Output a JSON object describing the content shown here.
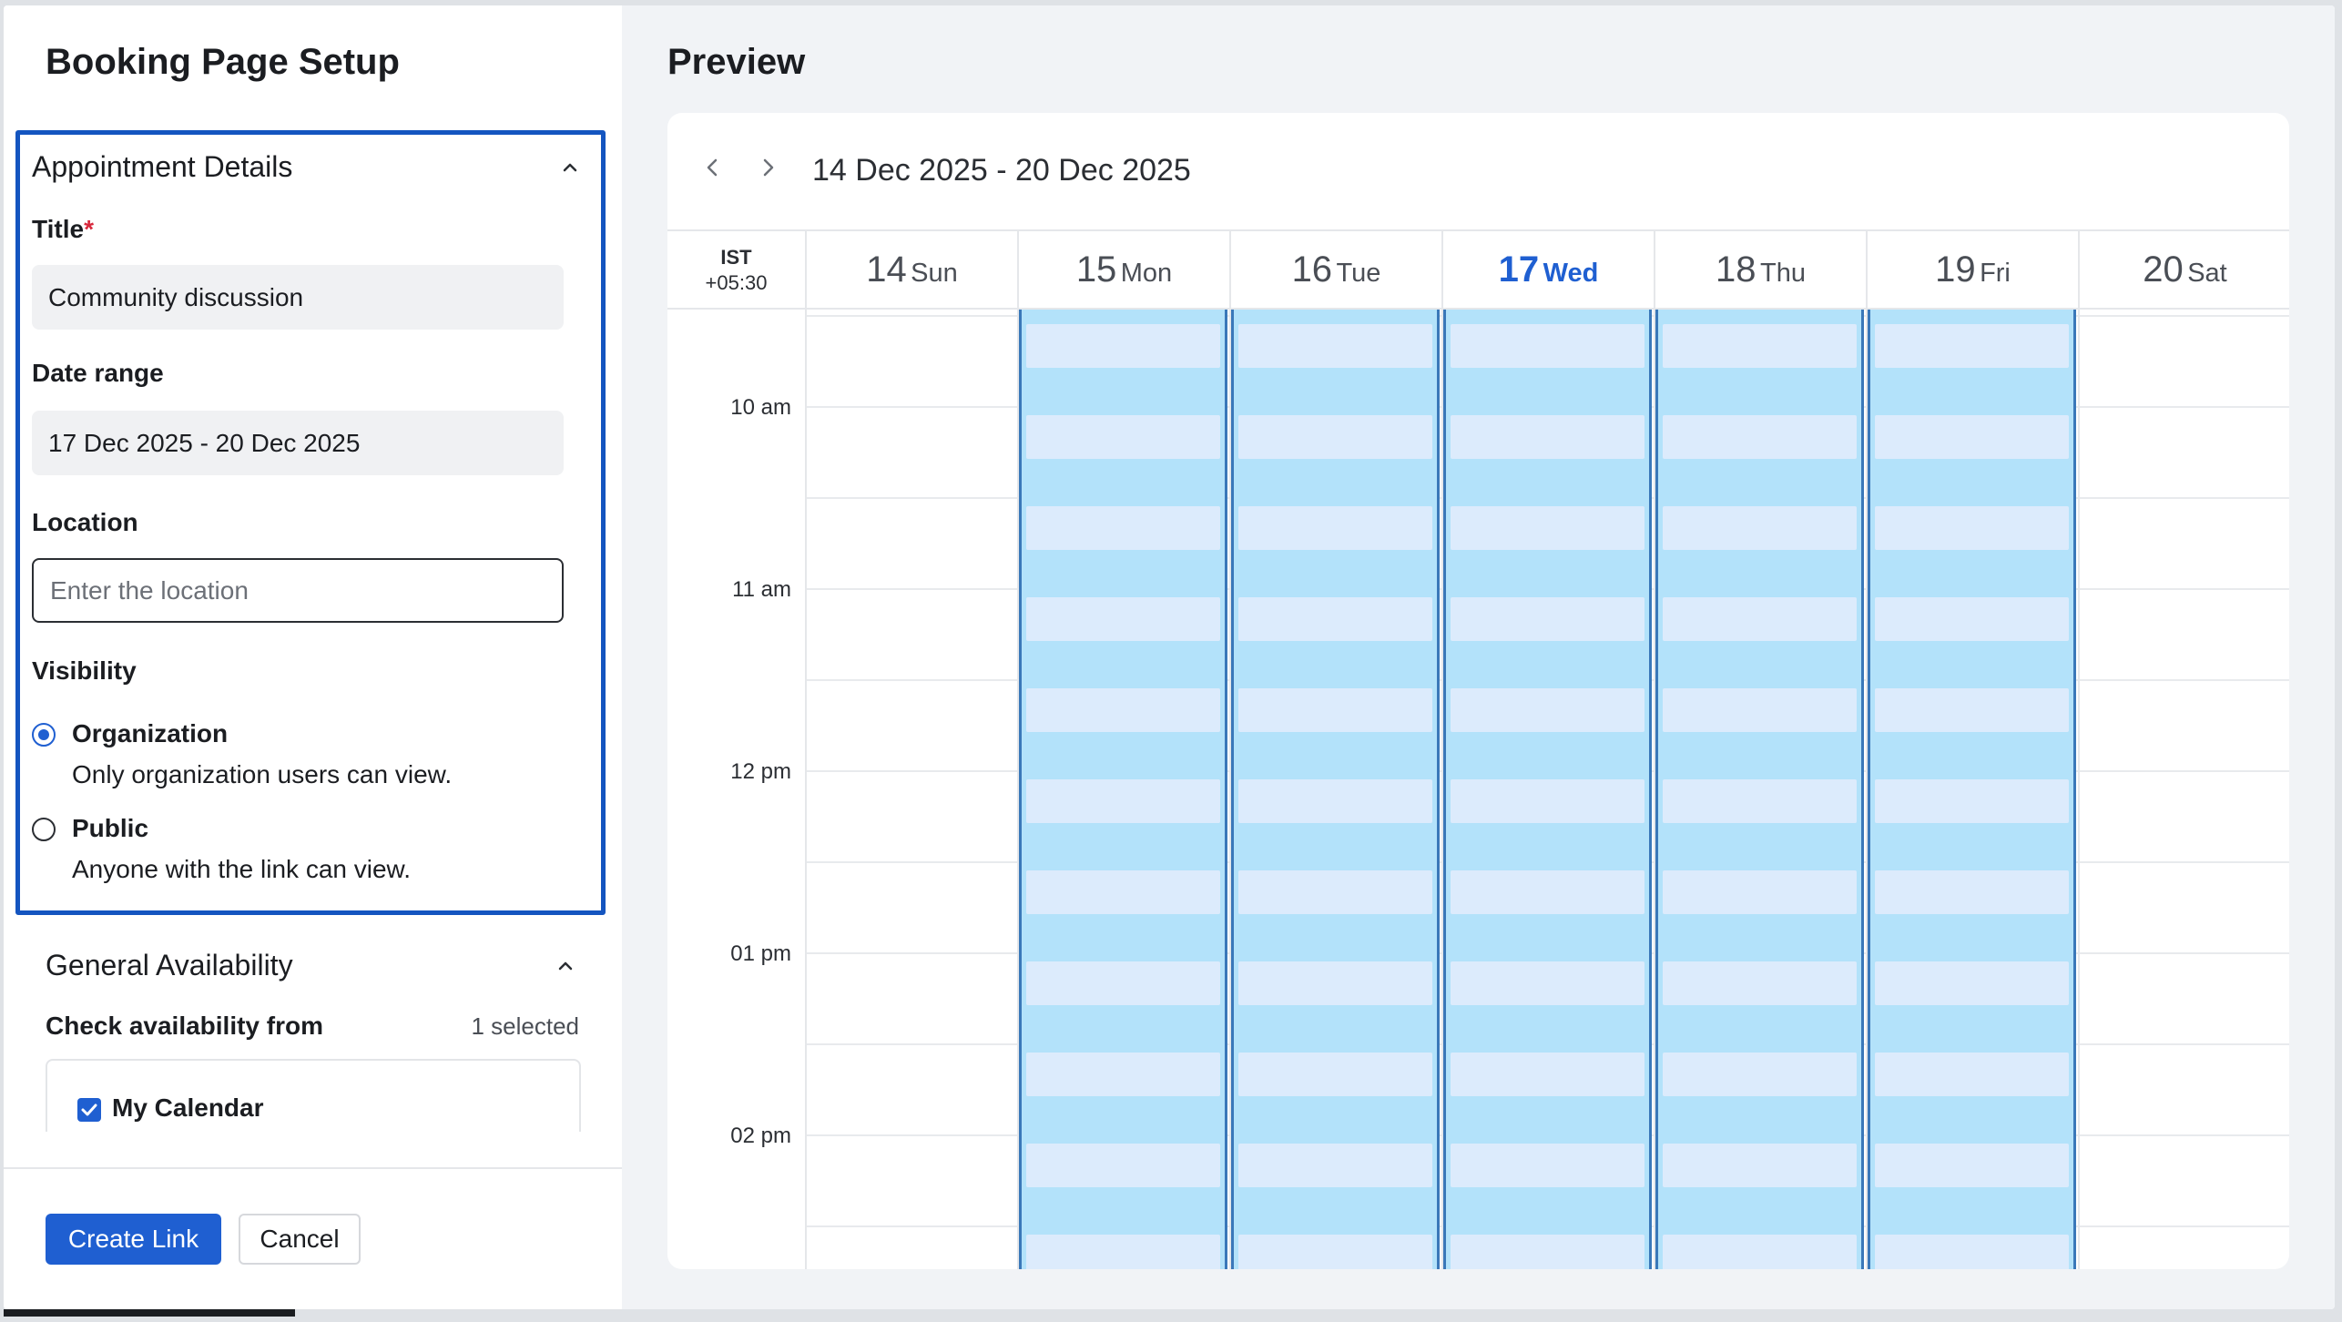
{
  "left_panel": {
    "title": "Booking Page Setup",
    "appointment_section": {
      "heading": "Appointment Details",
      "title_label": "Title",
      "required_mark": "*",
      "title_value": "Community discussion",
      "date_range_label": "Date range",
      "date_range_value": "17 Dec 2025 - 20 Dec 2025",
      "location_label": "Location",
      "location_placeholder": "Enter the location",
      "visibility_label": "Visibility",
      "visibility_options": [
        {
          "label": "Organization",
          "description": "Only organization users can view.",
          "selected": true
        },
        {
          "label": "Public",
          "description": "Anyone with the link can view.",
          "selected": false
        }
      ]
    },
    "availability_section": {
      "heading": "General Availability",
      "check_label": "Check availability from",
      "selected_count": "1 selected",
      "calendars": [
        {
          "label": "My Calendar",
          "checked": true
        }
      ]
    },
    "footer": {
      "create_label": "Create Link",
      "cancel_label": "Cancel"
    }
  },
  "preview": {
    "title": "Preview",
    "date_range": "14 Dec 2025 - 20 Dec 2025",
    "timezone": {
      "name": "IST",
      "offset": "+05:30"
    },
    "days": [
      {
        "num": "14",
        "name": "Sun",
        "today": false,
        "available": false
      },
      {
        "num": "15",
        "name": "Mon",
        "today": false,
        "available": true
      },
      {
        "num": "16",
        "name": "Tue",
        "today": false,
        "available": true
      },
      {
        "num": "17",
        "name": "Wed",
        "today": true,
        "available": true
      },
      {
        "num": "18",
        "name": "Thu",
        "today": false,
        "available": true
      },
      {
        "num": "19",
        "name": "Fri",
        "today": false,
        "available": true
      },
      {
        "num": "20",
        "name": "Sat",
        "today": false,
        "available": false
      }
    ],
    "time_labels": [
      "10 am",
      "11 am",
      "12 pm",
      "01 pm",
      "02 pm"
    ]
  },
  "colors": {
    "accent": "#1f5fd1",
    "section_border": "#1455c0",
    "available_fill": "#b3e2fa",
    "slot_fill": "#dcebfc",
    "required": "#d8283c"
  },
  "icons": {
    "collapse": "chevron-up-icon",
    "prev": "chevron-left-icon",
    "next": "chevron-right-icon",
    "checkbox": "checkmark-icon"
  }
}
